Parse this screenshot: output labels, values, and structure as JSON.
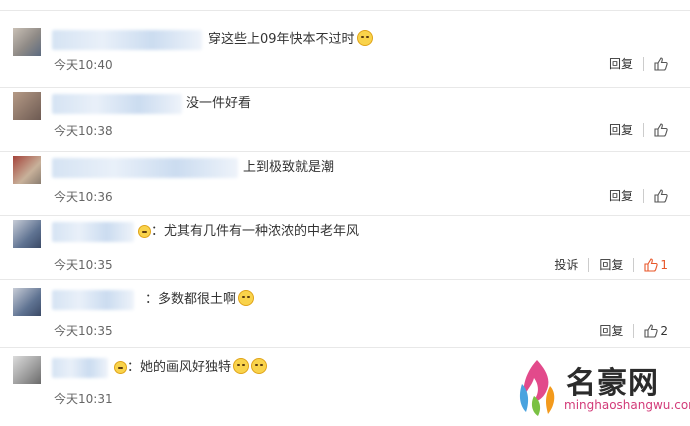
{
  "actions": {
    "reply": "回复",
    "report": "投诉"
  },
  "comments": [
    {
      "text": "穿这些上09年快本不过时",
      "time": "今天10:40",
      "likes": ""
    },
    {
      "text": "没一件好看",
      "time": "今天10:38",
      "likes": ""
    },
    {
      "text": "上到极致就是潮",
      "time": "今天10:36",
      "likes": ""
    },
    {
      "text": "：尤其有几件有一种浓浓的中老年风",
      "time": "今天10:35",
      "likes": "1"
    },
    {
      "text": "：多数都很土啊",
      "time": "今天10:35",
      "likes": "2"
    },
    {
      "text": "：她的画风好独特",
      "time": "今天10:31",
      "likes": ""
    }
  ],
  "colors": {
    "like_active": "#e8572a",
    "watermark_url": "#d23b79"
  },
  "watermark": {
    "name": "名豪网",
    "url": "minghaoshangwu.com"
  }
}
